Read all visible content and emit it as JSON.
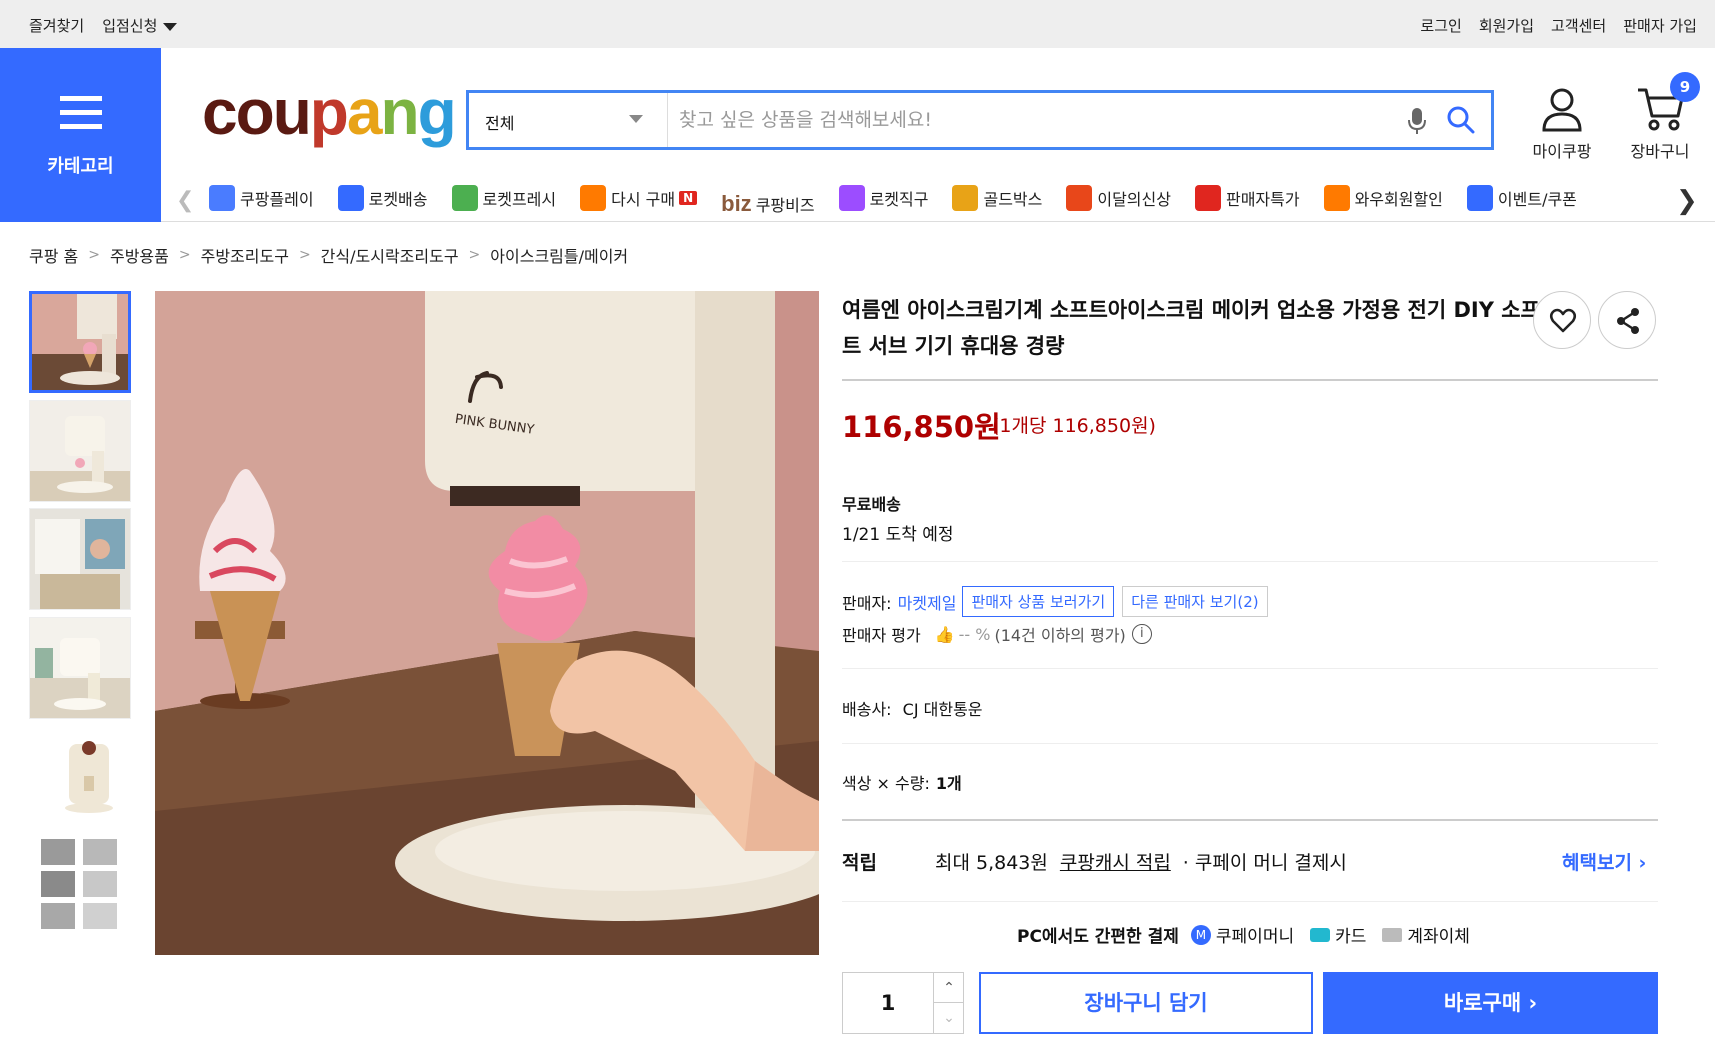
{
  "topbar": {
    "left": [
      "즐겨찾기",
      "입점신청"
    ],
    "right": [
      "로그인",
      "회원가입",
      "고객센터",
      "판매자 가입"
    ]
  },
  "header": {
    "category_label": "카테고리",
    "logo": "coupang",
    "search": {
      "category": "전체",
      "placeholder": "찾고 싶은 상품을 검색해보세요!"
    },
    "my_label": "마이쿠팡",
    "cart_label": "장바구니",
    "cart_count": "9"
  },
  "nav": {
    "items": [
      {
        "label": "쿠팡플레이",
        "icon": "play-icon",
        "color": "#4a7cff"
      },
      {
        "label": "로켓배송",
        "icon": "rocket-icon",
        "color": "#346aff"
      },
      {
        "label": "로켓프레시",
        "icon": "rocket-fresh-icon",
        "color": "#4caf50"
      },
      {
        "label": "다시 구매",
        "icon": "basket-icon",
        "color": "#ff7a00",
        "badge": "N"
      },
      {
        "label": "쿠팡비즈",
        "icon": "biz-icon",
        "color": "#8a5a3c",
        "prefix": "biz"
      },
      {
        "label": "로켓직구",
        "icon": "rocket-global-icon",
        "color": "#9c4dff"
      },
      {
        "label": "골드박스",
        "icon": "goldbox-icon",
        "color": "#e8a317"
      },
      {
        "label": "이달의신상",
        "icon": "new-icon",
        "color": "#e8471a"
      },
      {
        "label": "판매자특가",
        "icon": "percent-icon",
        "color": "#e0261f"
      },
      {
        "label": "와우회원할인",
        "icon": "wow-icon",
        "color": "#ff7a00"
      },
      {
        "label": "이벤트/쿠폰",
        "icon": "event-icon",
        "color": "#346aff"
      }
    ]
  },
  "breadcrumb": [
    "쿠팡 홈",
    "주방용품",
    "주방조리도구",
    "간식/도시락조리도구",
    "아이스크림틀/메이커"
  ],
  "product": {
    "title": "여름엔 아이스크림기계 소프트아이스크림 메이커 업소용 가정용 전기 DIY 소프트 서브 기기 휴대용 경량",
    "price": "116,850원",
    "unit_price": "(1개당 116,850원)",
    "shipping": "무료배송",
    "arrival": "1/21 도착 예정",
    "seller_label": "판매자:",
    "seller_name": "마켓제일",
    "seller_products_btn": "판매자 상품 보러가기",
    "other_sellers_btn": "다른 판매자 보기(2)",
    "seller_rating_label": "판매자 평가",
    "seller_rating_value": "-- %",
    "seller_rating_note": "(14건 이하의 평가)",
    "carrier_label": "배송사:",
    "carrier": "CJ 대한통운",
    "option_label": "색상 × 수량:",
    "option_value": "1개",
    "reward_label": "적립",
    "reward_amount": "최대 5,843원",
    "reward_link": "쿠팡캐시 적립",
    "reward_note": "· 쿠페이 머니 결제시",
    "benefit_link": "혜택보기 ›",
    "pc_pay_label": "PC에서도 간편한 결제",
    "pay_methods": [
      {
        "label": "쿠페이머니",
        "icon": "coupay-money-icon",
        "color": "#346aff"
      },
      {
        "label": "카드",
        "icon": "card-icon",
        "color": "#22b8cf"
      },
      {
        "label": "계좌이체",
        "icon": "bank-icon",
        "color": "#aaaaaa"
      }
    ],
    "quantity": "1",
    "cart_button": "장바구니 담기",
    "buy_button": "바로구매 ›",
    "image_brand": "PINK BUNNY"
  }
}
